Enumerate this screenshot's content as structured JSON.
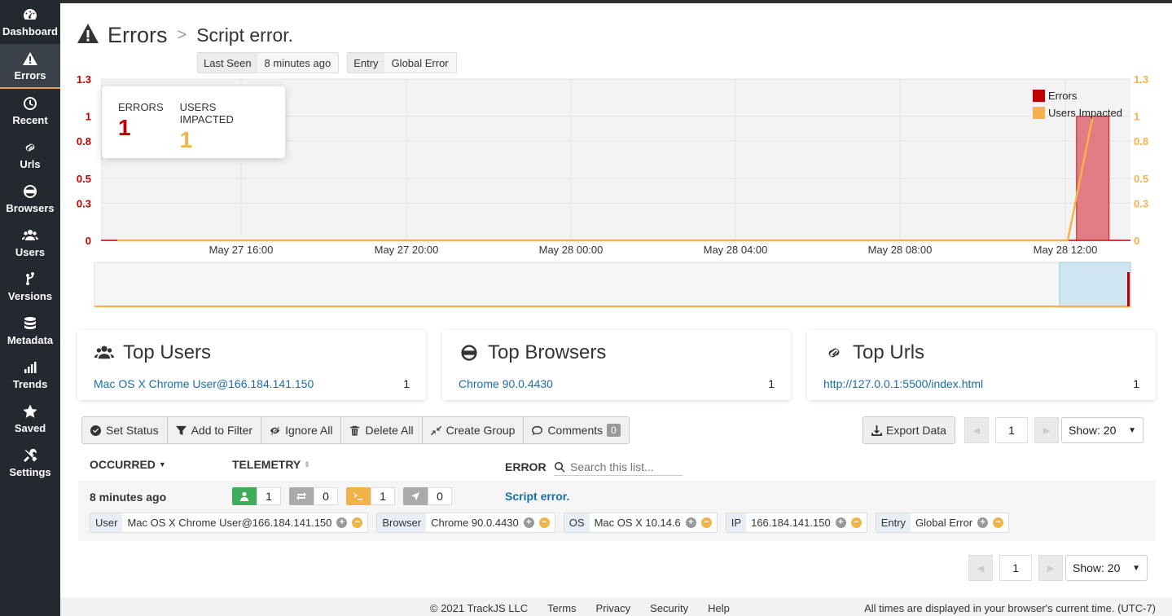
{
  "sidebar": {
    "items": [
      {
        "label": "Dashboard",
        "icon": "dashboard-icon"
      },
      {
        "label": "Errors",
        "icon": "warning-icon",
        "active": true
      },
      {
        "label": "Recent",
        "icon": "clock-icon"
      },
      {
        "label": "Urls",
        "icon": "link-icon"
      },
      {
        "label": "Browsers",
        "icon": "www-icon"
      },
      {
        "label": "Users",
        "icon": "users-icon"
      },
      {
        "label": "Versions",
        "icon": "branch-icon"
      },
      {
        "label": "Metadata",
        "icon": "database-icon"
      },
      {
        "label": "Trends",
        "icon": "bars-icon"
      },
      {
        "label": "Saved",
        "icon": "star-icon"
      },
      {
        "label": "Settings",
        "icon": "tools-icon"
      }
    ]
  },
  "header": {
    "title": "Errors",
    "separator": ">",
    "subtitle": "Script error.",
    "pills": [
      {
        "key": "Last Seen",
        "value": "8 minutes ago"
      },
      {
        "key": "Entry",
        "value": "Global Error"
      }
    ]
  },
  "stats": {
    "errors_label": "ERRORS",
    "errors_value": "1",
    "users_label": "USERS IMPACTED",
    "users_value": "1"
  },
  "colors": {
    "errors": "#c00000",
    "users": "#f5b14c",
    "link": "#1a6ea8"
  },
  "chart_data": {
    "type": "bar",
    "x_ticks": [
      "May 27 16:00",
      "May 27 20:00",
      "May 28 00:00",
      "May 28 04:00",
      "May 28 08:00",
      "May 28 12:00"
    ],
    "y_ticks_left": [
      "1.3",
      "1",
      "0.8",
      "0.5",
      "0.3",
      "0"
    ],
    "y_ticks_right": [
      "1.3",
      "1",
      "0.8",
      "0.5",
      "0.3",
      "0"
    ],
    "ylim": [
      0,
      1.3
    ],
    "grid": true,
    "legend_position": "top-right",
    "series": [
      {
        "name": "Errors",
        "type": "bar",
        "x": [
          "May 28 13:00"
        ],
        "values": [
          1
        ]
      },
      {
        "name": "Users Impacted",
        "type": "line",
        "x": [
          "May 28 12:00",
          "May 28 13:00"
        ],
        "values": [
          0,
          1
        ]
      }
    ]
  },
  "cards": [
    {
      "title": "Top Users",
      "icon": "users-icon",
      "link": "Mac OS X Chrome User@166.184.141.150",
      "count": "1"
    },
    {
      "title": "Top Browsers",
      "icon": "www-icon",
      "link": "Chrome 90.0.4430",
      "count": "1"
    },
    {
      "title": "Top Urls",
      "icon": "link-icon",
      "link": "http://127.0.0.1:5500/index.html",
      "count": "1"
    }
  ],
  "toolbar": {
    "set_status": "Set Status",
    "add_filter": "Add to Filter",
    "ignore_all": "Ignore All",
    "delete_all": "Delete All",
    "create_group": "Create Group",
    "comments": "Comments",
    "comments_count": "0",
    "export": "Export Data"
  },
  "pagination": {
    "page": "1",
    "show": "Show: 20"
  },
  "table": {
    "col_occurred": "OCCURRED",
    "col_telemetry": "TELEMETRY",
    "col_error": "ERROR",
    "search_placeholder": "Search this list...",
    "row": {
      "occurred": "8 minutes ago",
      "telemetry": [
        {
          "icon": "user-icon",
          "color": "#3fae5a",
          "count": "1"
        },
        {
          "icon": "network-icon",
          "color": "#aaaaaa",
          "count": "0"
        },
        {
          "icon": "console-icon",
          "color": "#f0b34a",
          "count": "1"
        },
        {
          "icon": "navigation-icon",
          "color": "#aaaaaa",
          "count": "0"
        }
      ],
      "error": "Script error.",
      "chips": [
        {
          "key": "User",
          "value": "Mac OS X Chrome User@166.184.141.150"
        },
        {
          "key": "Browser",
          "value": "Chrome 90.0.4430"
        },
        {
          "key": "OS",
          "value": "Mac OS X 10.14.6"
        },
        {
          "key": "IP",
          "value": "166.184.141.150"
        },
        {
          "key": "Entry",
          "value": "Global Error"
        }
      ]
    }
  },
  "footer": {
    "copyright": "© 2021 TrackJS LLC",
    "links": [
      "Terms",
      "Privacy",
      "Security",
      "Help"
    ],
    "note": "All times are displayed in your browser's current time. (UTC-7)"
  }
}
